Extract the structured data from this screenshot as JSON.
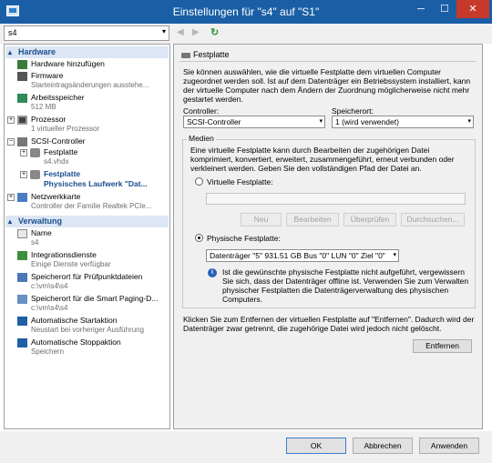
{
  "window": {
    "title": "Einstellungen für \"s4\" auf \"S1\"",
    "min": "─",
    "max": "☐",
    "close": "✕"
  },
  "vm_select": {
    "value": "s4",
    "arrow": "▾"
  },
  "nav": {
    "back": "◀",
    "forward": "▶",
    "refresh": "↻"
  },
  "sidebar": {
    "hardware_header": "Hardware",
    "management_header": "Verwaltung",
    "collapse_glyph": "▴",
    "items": [
      {
        "label": "Hardware hinzufügen",
        "sub": ""
      },
      {
        "label": "Firmware",
        "sub": "Starteintragsänderungen ausstehe..."
      },
      {
        "label": "Arbeitsspeicher",
        "sub": "512 MB"
      },
      {
        "label": "Prozessor",
        "sub": "1 virtueller Prozessor"
      },
      {
        "label": "SCSI-Controller",
        "sub": ""
      },
      {
        "label": "Festplatte",
        "sub": "s4.vhdx"
      },
      {
        "label": "Festplatte",
        "sub": "Physisches Laufwerk \"Dat..."
      },
      {
        "label": "Netzwerkkarte",
        "sub": "Controller der Familie Realtek PCIe..."
      }
    ],
    "mgmt_items": [
      {
        "label": "Name",
        "sub": "s4"
      },
      {
        "label": "Integrationsdienste",
        "sub": "Einige Dienste verfügbar"
      },
      {
        "label": "Speicherort für Prüfpunktdateien",
        "sub": "c:\\vm\\s4\\s4"
      },
      {
        "label": "Speicherort für die Smart Paging-D...",
        "sub": "c:\\vm\\s4\\s4"
      },
      {
        "label": "Automatische Startaktion",
        "sub": "Neustart bei vorheriger Ausführung"
      },
      {
        "label": "Automatische Stoppaktion",
        "sub": "Speichern"
      }
    ],
    "expand_plus": "+",
    "expand_minus": "−"
  },
  "panel": {
    "title": "Festplatte",
    "intro": "Sie können auswählen, wie die virtuelle Festplatte dem virtuellen Computer zugeordnet werden soll. Ist auf dem Datenträger ein Betriebssystem installiert, kann der virtuelle Computer nach dem Ändern der Zuordnung möglicherweise nicht mehr gestartet werden.",
    "controller_label": "Controller:",
    "controller_value": "SCSI-Controller",
    "location_label": "Speicherort:",
    "location_value": "1 (wird verwendet)",
    "media_label": "Medien",
    "media_text": "Eine virtuelle Festplatte kann durch Bearbeiten der zugehörigen Datei komprimiert, konvertiert, erweitert, zusammengeführt, erneut verbunden oder verkleinert werden. Geben Sie den vollständigen Pfad der Datei an.",
    "virtual_disk_label": "Virtuelle Festplatte:",
    "virtual_disk_value": "",
    "btn_new": "Neu",
    "btn_edit": "Bearbeiten",
    "btn_check": "Überprüfen",
    "btn_browse": "Durchsuchen...",
    "physical_disk_label": "Physische Festplatte:",
    "physical_disk_value": "Datenträger \"5\" 931.51 GB Bus \"0\" LUN \"0\" Ziel \"0\"",
    "info_text": "Ist die gewünschte physische Festplatte nicht aufgeführt, vergewissern Sie sich, dass der Datenträger offline ist. Verwenden Sie zum Verwalten physischer Festplatten die Datenträgerverwaltung des physischen Computers.",
    "remove_text": "Klicken Sie zum Entfernen der virtuellen Festplatte auf \"Entfernen\". Dadurch wird der Datenträger zwar getrennt, die zugehörige Datei wird jedoch nicht gelöscht.",
    "btn_remove": "Entfernen",
    "info_glyph": "i"
  },
  "footer": {
    "ok": "OK",
    "cancel": "Abbrechen",
    "apply": "Anwenden"
  }
}
